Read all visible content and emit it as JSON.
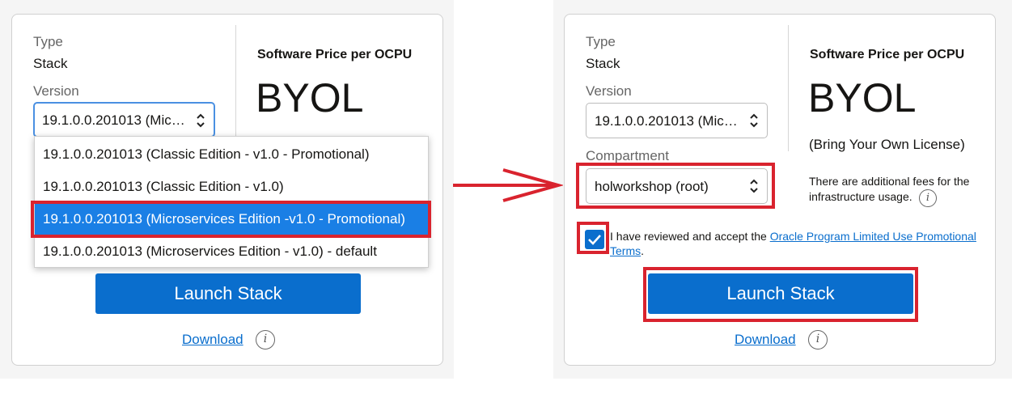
{
  "left": {
    "type_label": "Type",
    "type_value": "Stack",
    "version_label": "Version",
    "version_selected": "19.1.0.0.201013 (Mic…",
    "price_title": "Software Price per OCPU",
    "byol": "BYOL",
    "options": [
      "19.1.0.0.201013 (Classic Edition - v1.0 - Promotional)",
      "19.1.0.0.201013 (Classic Edition - v1.0)",
      "19.1.0.0.201013 (Microservices Edition -v1.0 - Promotional)",
      "19.1.0.0.201013 (Microservices Edition - v1.0) - default"
    ],
    "launch_label": "Launch Stack",
    "download_label": "Download",
    "info_glyph": "i"
  },
  "right": {
    "type_label": "Type",
    "type_value": "Stack",
    "version_label": "Version",
    "version_selected": "19.1.0.0.201013 (Mic…",
    "compartment_label": "Compartment",
    "compartment_selected": "holworkshop (root)",
    "price_title": "Software Price per OCPU",
    "byol": "BYOL",
    "byol_desc": "(Bring Your Own License)",
    "fees_text": "There are additional fees for the infrastructure usage.",
    "terms_prefix": "I have reviewed and accept the ",
    "terms_link": "Oracle Program Limited Use Promotional Terms",
    "terms_suffix": ".",
    "launch_label": "Launch Stack",
    "download_label": "Download",
    "info_glyph": "i"
  },
  "colors": {
    "accent": "#0a6ecd",
    "highlight": "#d9232e",
    "selected_option": "#1a7fe5"
  },
  "icons": [
    "chevron-updown-icon",
    "info-icon",
    "arrow-right-icon",
    "checkmark-icon"
  ]
}
